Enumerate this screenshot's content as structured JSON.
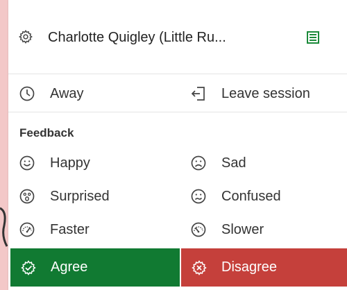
{
  "header": {
    "participant_name": "Charlotte Quigley (Little Ru...",
    "settings_icon": "gear-icon",
    "list_icon": "list-icon"
  },
  "status": {
    "away_label": "Away",
    "away_icon": "clock-icon",
    "leave_label": "Leave session",
    "leave_icon": "exit-door-icon"
  },
  "feedback": {
    "title": "Feedback",
    "items": [
      {
        "label": "Happy",
        "icon": "happy-face-icon"
      },
      {
        "label": "Sad",
        "icon": "sad-face-icon"
      },
      {
        "label": "Surprised",
        "icon": "surprised-face-icon"
      },
      {
        "label": "Confused",
        "icon": "confused-face-icon"
      },
      {
        "label": "Faster",
        "icon": "speedometer-fast-icon"
      },
      {
        "label": "Slower",
        "icon": "speedometer-slow-icon"
      }
    ],
    "agree_label": "Agree",
    "agree_icon": "check-badge-icon",
    "disagree_label": "Disagree",
    "disagree_icon": "x-badge-icon"
  },
  "colors": {
    "agree_bg": "#117a32",
    "disagree_bg": "#c5403b",
    "list_icon_green": "#1b8a3a",
    "background": "#f3c8c8"
  }
}
